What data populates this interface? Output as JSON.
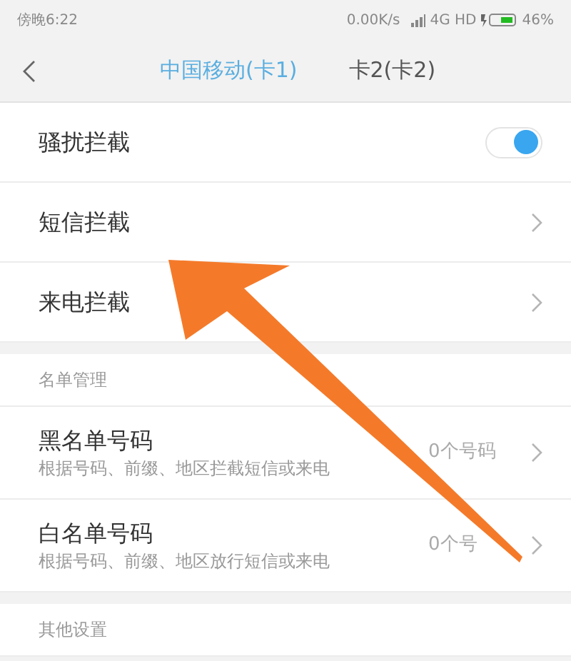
{
  "status_bar": {
    "time": "傍晚6:22",
    "speed": "0.00K/s",
    "network": "4G HD",
    "battery": "46%"
  },
  "nav": {
    "tabs": [
      {
        "label": "中国移动(卡1)",
        "selected": true
      },
      {
        "label": "卡2(卡2)",
        "selected": false
      }
    ]
  },
  "sections": [
    {
      "items": [
        {
          "kind": "toggle",
          "title": "骚扰拦截",
          "on": true
        },
        {
          "kind": "link",
          "title": "短信拦截"
        },
        {
          "kind": "link",
          "title": "来电拦截"
        }
      ]
    },
    {
      "header": "名单管理",
      "items": [
        {
          "kind": "link",
          "title": "黑名单号码",
          "subtitle": "根据号码、前缀、地区拦截短信或来电",
          "value": "0个号码"
        },
        {
          "kind": "link",
          "title": "白名单号码",
          "subtitle": "根据号码、前缀、地区放行短信或来电",
          "value": "0个号"
        }
      ]
    },
    {
      "header": "其他设置"
    }
  ]
}
